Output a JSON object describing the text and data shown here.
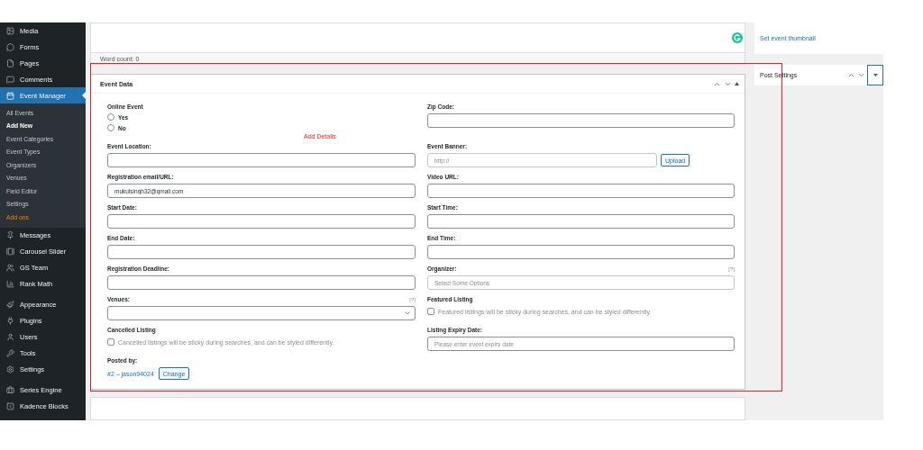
{
  "sidebar": {
    "groups": [
      [
        {
          "label": "Media",
          "selected": false
        },
        {
          "label": "Forms",
          "selected": false
        },
        {
          "label": "Pages",
          "selected": false
        },
        {
          "label": "Comments",
          "selected": false
        },
        {
          "label": "Event Manager",
          "selected": true,
          "children": [
            {
              "label": "All Events",
              "selected": false,
              "kind": "link"
            },
            {
              "label": "Add New",
              "selected": true,
              "kind": "link"
            },
            {
              "label": "Event Categories",
              "selected": false,
              "kind": "link"
            },
            {
              "label": "Event Types",
              "selected": false,
              "kind": "link"
            },
            {
              "label": "Organizers",
              "selected": false,
              "kind": "link"
            },
            {
              "label": "Venues",
              "selected": false,
              "kind": "link"
            },
            {
              "label": "Field Editor",
              "selected": false,
              "kind": "link"
            },
            {
              "label": "Settings",
              "selected": false,
              "kind": "link"
            },
            {
              "label": "Add ons",
              "selected": false,
              "kind": "addon"
            }
          ]
        },
        {
          "label": "Messages",
          "selected": false
        },
        {
          "label": "Carousel Slider",
          "selected": false
        },
        {
          "label": "GS Team",
          "selected": false
        },
        {
          "label": "Rank Math",
          "selected": false
        }
      ],
      [
        {
          "label": "Appearance",
          "selected": false
        },
        {
          "label": "Plugins",
          "selected": false
        },
        {
          "label": "Users",
          "selected": false
        },
        {
          "label": "Tools",
          "selected": false
        },
        {
          "label": "Settings",
          "selected": false
        }
      ],
      [
        {
          "label": "Series Engine",
          "selected": false
        },
        {
          "label": "Kadence Blocks",
          "selected": false
        }
      ]
    ]
  },
  "editor": {
    "word_count": "Word count: 0"
  },
  "event_data": {
    "title": "Event Data",
    "fields": [
      {
        "kind": "radio",
        "label": "Online Event",
        "options": [
          {
            "label": "Yes",
            "selected": false
          },
          {
            "label": "No",
            "selected": false
          }
        ]
      },
      {
        "kind": "text",
        "label": "Zip Code:"
      },
      {
        "kind": "text",
        "label": "Event Location:"
      },
      {
        "kind": "upload",
        "label": "Event Banner:",
        "placeholder": "http://",
        "button": "Upload"
      },
      {
        "kind": "text",
        "label": "Registration email/URL:",
        "value": "mukulsingh32@gmail.com"
      },
      {
        "kind": "text",
        "label": "Video URL:"
      },
      {
        "kind": "text",
        "label": "Start Date:"
      },
      {
        "kind": "text",
        "label": "Start Time:"
      },
      {
        "kind": "text",
        "label": "End Date:"
      },
      {
        "kind": "text",
        "label": "End Time:"
      },
      {
        "kind": "text",
        "label": "Registration Deadline:"
      },
      {
        "kind": "multiselect",
        "label": "Organizer:",
        "help": "[?]",
        "placeholder": "Select Some Options"
      },
      {
        "kind": "select",
        "label": "Venues:",
        "help": "[?]"
      },
      {
        "kind": "checkbox",
        "label": "Featured Listing",
        "text": "Featured listings will be sticky during searches, and can be styled differently.",
        "checked": false
      },
      {
        "kind": "checkbox",
        "label": "Cancelled Listing",
        "text": "Cancelled listings will be sticky during searches, and can be styled differently.",
        "checked": false
      },
      {
        "kind": "text",
        "label": "Listing Expiry Date:",
        "placeholder": "Please enter event expiry date"
      },
      {
        "kind": "author",
        "label": "Posted by:",
        "link": "#2 – jason94024",
        "button": "Change"
      }
    ]
  },
  "annotation": {
    "label": "Add Details"
  },
  "right_panel": {
    "thumbnail_link": "Set event thumbnail",
    "post_settings": {
      "title": "Post Settings"
    }
  }
}
